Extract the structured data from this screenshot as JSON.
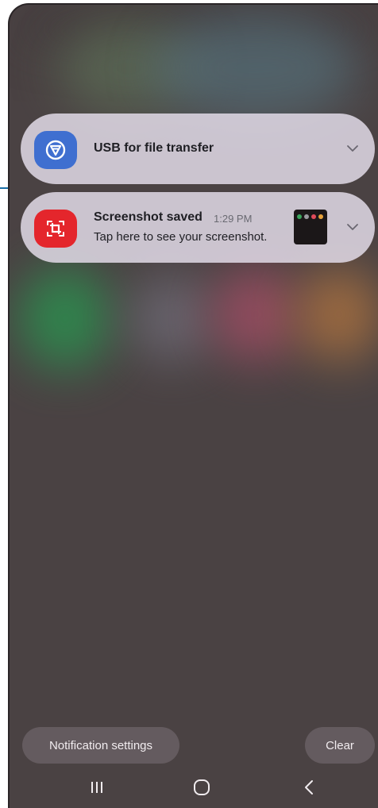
{
  "notifications": {
    "usb": {
      "title": "USB for file transfer",
      "icon": "usb-icon",
      "accent": "#3f6fd0"
    },
    "screenshot": {
      "title": "Screenshot saved",
      "time": "1:29 PM",
      "body": "Tap here to see your screenshot.",
      "icon": "screenshot-icon",
      "accent": "#e4262c"
    }
  },
  "footer": {
    "settings_label": "Notification settings",
    "clear_label": "Clear"
  },
  "nav": {
    "recent": "recent-apps-icon",
    "home": "home-icon",
    "back": "back-icon"
  },
  "colors": {
    "background": "#4a4243",
    "card": "#e1dae6",
    "pointer_line": "#1a6fa6"
  }
}
